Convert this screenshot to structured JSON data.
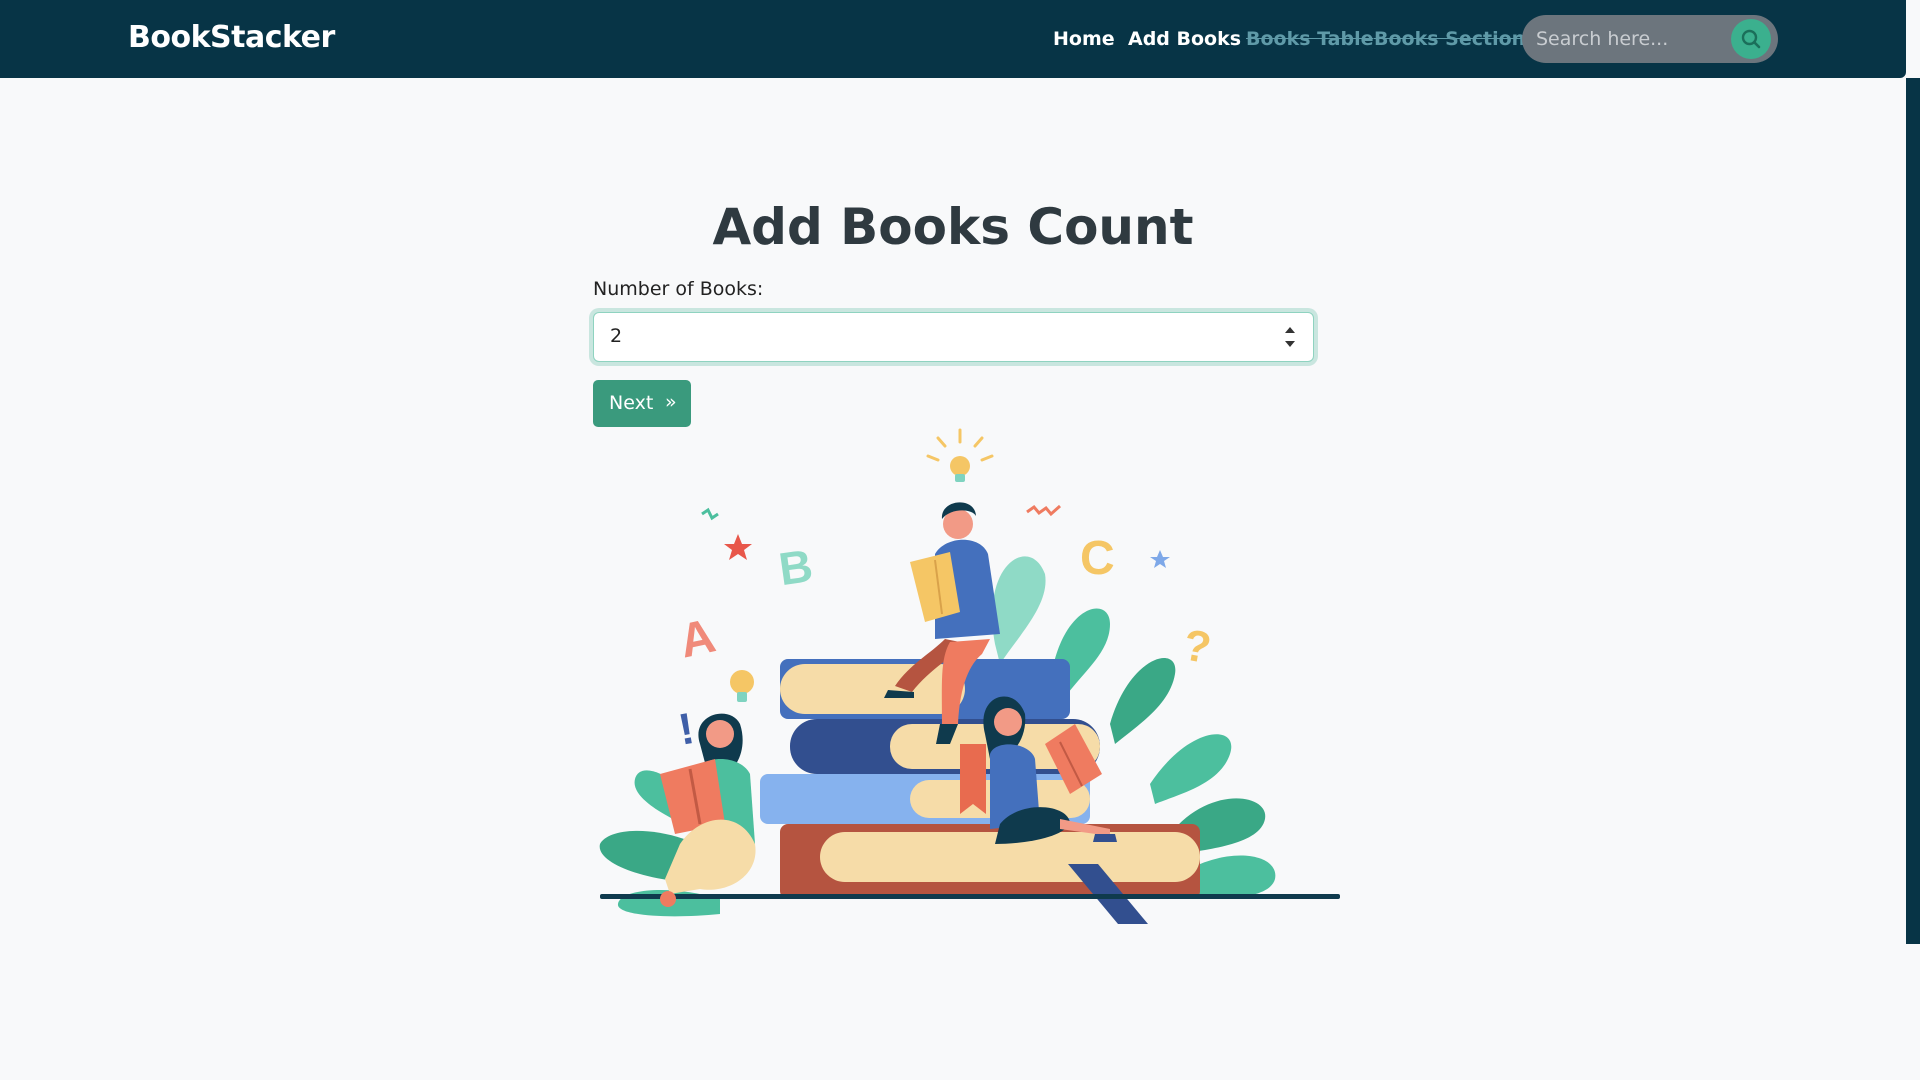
{
  "navbar": {
    "brand": "BookStacker",
    "links": [
      {
        "label": "Home",
        "disabled": false
      },
      {
        "label": "Add Books",
        "disabled": false
      },
      {
        "label": "Books Table",
        "disabled": true
      },
      {
        "label": "Books Section",
        "disabled": true
      }
    ],
    "search": {
      "placeholder": "Search here...",
      "icon": "search-icon"
    }
  },
  "main": {
    "title": "Add Books Count",
    "field_label": "Number of Books:",
    "field_value": "2",
    "next_label": "Next",
    "next_arrow": "»",
    "illustration_letters": [
      "A",
      "B",
      "C",
      "!",
      "?"
    ]
  },
  "colors": {
    "navbar_bg": "#073446",
    "accent": "#3bb08e",
    "button": "#3a9a7d",
    "page_bg": "#f8f9fa"
  }
}
